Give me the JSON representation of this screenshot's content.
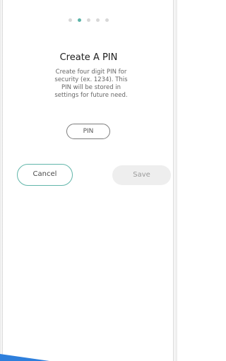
{
  "pagination": {
    "dots": [
      false,
      true,
      false,
      false,
      false
    ],
    "active_color": "#5bb3a7",
    "inactive_color": "#d8d8d8"
  },
  "dialog": {
    "title": "Create A PIN",
    "description": "Create four digit PIN for security (ex. 1234). This PIN will be stored in settings for future need.",
    "pin_label": "PIN"
  },
  "actions": {
    "cancel_label": "Cancel",
    "save_label": "Save",
    "cancel_border_color": "#62b6aa",
    "save_bg_color": "#eeeeee"
  },
  "colors": {
    "bottom_accent": "#2e7fdc"
  }
}
